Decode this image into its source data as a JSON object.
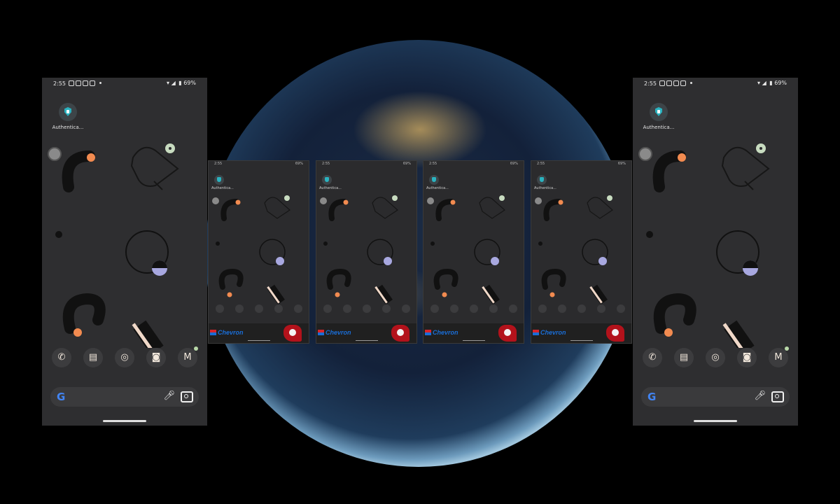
{
  "phone": {
    "status": {
      "time": "2:55",
      "battery": "69%"
    },
    "app": {
      "label": "Authentica..."
    },
    "dock": {
      "phone": "phone-icon",
      "messages": "messages-icon",
      "chrome": "chrome-icon",
      "camera": "camera-icon",
      "gmail": "gmail-icon"
    },
    "search": {
      "logo": "G"
    }
  },
  "thumbnails": [
    {
      "time": "2:55",
      "battery": "69%",
      "app_label": "Authentica...",
      "ad_brand": "Chevron"
    },
    {
      "time": "2:55",
      "battery": "69%",
      "app_label": "Authentica...",
      "ad_brand": "Chevron"
    },
    {
      "time": "2:55",
      "battery": "69%",
      "app_label": "Authentica...",
      "ad_brand": "Chevron"
    },
    {
      "time": "2:55",
      "battery": "69%",
      "app_label": "Authentica...",
      "ad_brand": "Chevron"
    }
  ],
  "colors": {
    "background": "#000000",
    "screen": "#2e2e30",
    "orange": "#f28b50",
    "lavender": "#a8a8e0",
    "mint": "#c8dcc0",
    "cream": "#f0d8c8",
    "teal": "#2ab3c0"
  }
}
